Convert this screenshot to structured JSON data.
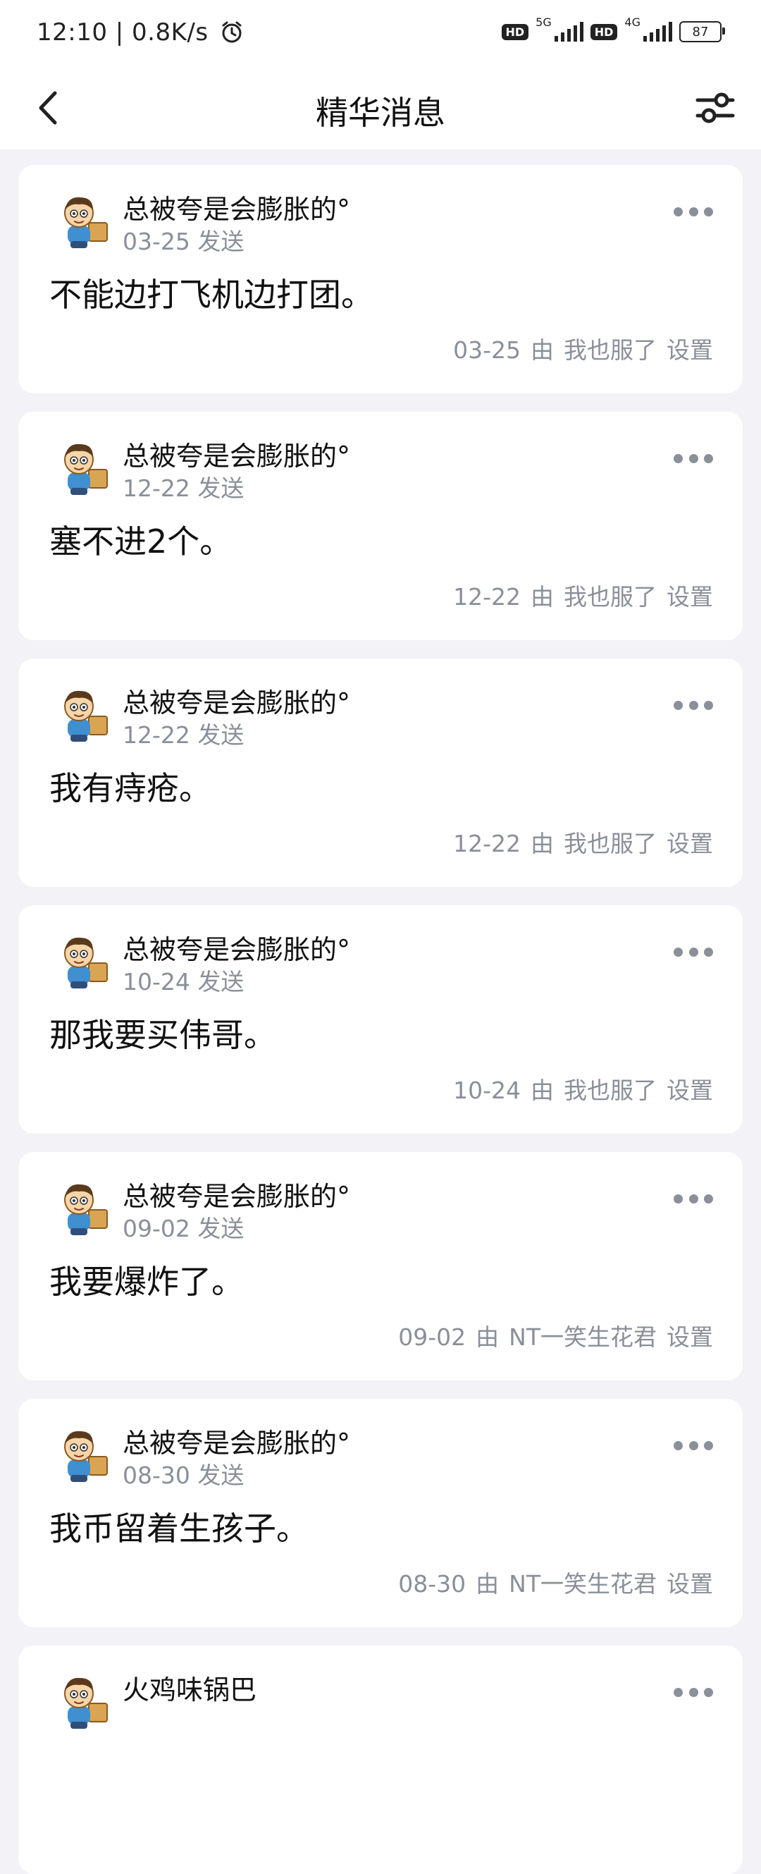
{
  "status_bar": {
    "left": "12:10 | 0.8K/s",
    "net1": "5G",
    "net2": "4G",
    "hd1": "HD",
    "hd2": "HD",
    "battery": "87"
  },
  "header": {
    "title": "精华消息"
  },
  "cards": [
    {
      "name": "总被夸是会膨胀的°",
      "sent": "03-25 发送",
      "message": "不能边打飞机边打团。",
      "meta_date": "03-25",
      "meta_by": "由",
      "meta_user": "我也服了",
      "meta_action": "设置"
    },
    {
      "name": "总被夸是会膨胀的°",
      "sent": "12-22 发送",
      "message": "塞不进2个。",
      "meta_date": "12-22",
      "meta_by": "由",
      "meta_user": "我也服了",
      "meta_action": "设置"
    },
    {
      "name": "总被夸是会膨胀的°",
      "sent": "12-22 发送",
      "message": "我有痔疮。",
      "meta_date": "12-22",
      "meta_by": "由",
      "meta_user": "我也服了",
      "meta_action": "设置"
    },
    {
      "name": "总被夸是会膨胀的°",
      "sent": "10-24 发送",
      "message": "那我要买伟哥。",
      "meta_date": "10-24",
      "meta_by": "由",
      "meta_user": "我也服了",
      "meta_action": "设置"
    },
    {
      "name": "总被夸是会膨胀的°",
      "sent": "09-02 发送",
      "message": "我要爆炸了。",
      "meta_date": "09-02",
      "meta_by": "由",
      "meta_user": "NT一笑生花君",
      "meta_action": "设置"
    },
    {
      "name": "总被夸是会膨胀的°",
      "sent": "08-30 发送",
      "message": "我币留着生孩子。",
      "meta_date": "08-30",
      "meta_by": "由",
      "meta_user": "NT一笑生花君",
      "meta_action": "设置"
    },
    {
      "name": "火鸡味锅巴",
      "sent": "",
      "message": "",
      "meta_date": "",
      "meta_by": "",
      "meta_user": "",
      "meta_action": ""
    }
  ],
  "icons": {
    "back": "chevron-left-icon",
    "settings": "sliders-icon",
    "more": "more-horizontal-icon",
    "alarm": "alarm-clock-icon",
    "avatar": "cartoon-boy-avatar"
  }
}
